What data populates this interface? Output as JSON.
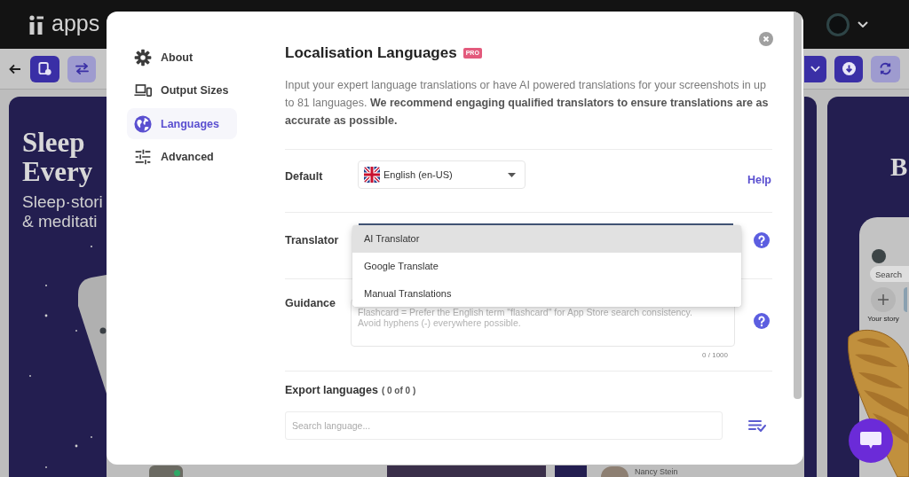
{
  "app_background": {
    "logo": "apps",
    "left_screenshot": {
      "headline": [
        "Sleep",
        "Every"
      ],
      "subline": [
        "Sleep·stori",
        "& meditati"
      ]
    },
    "right_screenshot": {
      "headline": "B",
      "search_placeholder": "Search",
      "story_label": "Your story"
    },
    "bottom_strip": {
      "name": "Nancy Stein"
    }
  },
  "modal": {
    "sidebar": {
      "items": [
        {
          "label": "About",
          "selected": false
        },
        {
          "label": "Output Sizes",
          "selected": false
        },
        {
          "label": "Languages",
          "selected": true
        },
        {
          "label": "Advanced",
          "selected": false
        }
      ]
    },
    "title": "Localisation Languages",
    "badge": "PRO",
    "description": "Input your expert language translations or have AI powered translations for your screenshots in up to 81 languages. **We recommend engaging qualified translators to ensure translations are as accurate as possible.**",
    "default": {
      "label": "Default",
      "value": "English (en-US)",
      "link": "Help"
    },
    "translator": {
      "label": "Translator",
      "options": [
        {
          "label": "AI Translator",
          "selected": true
        },
        {
          "label": "Google Translate",
          "selected": false
        },
        {
          "label": "Manual Translations",
          "selected": false
        }
      ]
    },
    "guidance": {
      "label": "Guidance",
      "placeholder": "Flashcard = Prefer the English term \"flashcard\" for App Store search consistency.\nAvoid hyphens (-) everywhere possible.",
      "counter": "0 / 1000"
    },
    "export_languages": {
      "label": "Export languages",
      "count": "( 0 of 0 )",
      "search_placeholder": "Search language..."
    }
  }
}
